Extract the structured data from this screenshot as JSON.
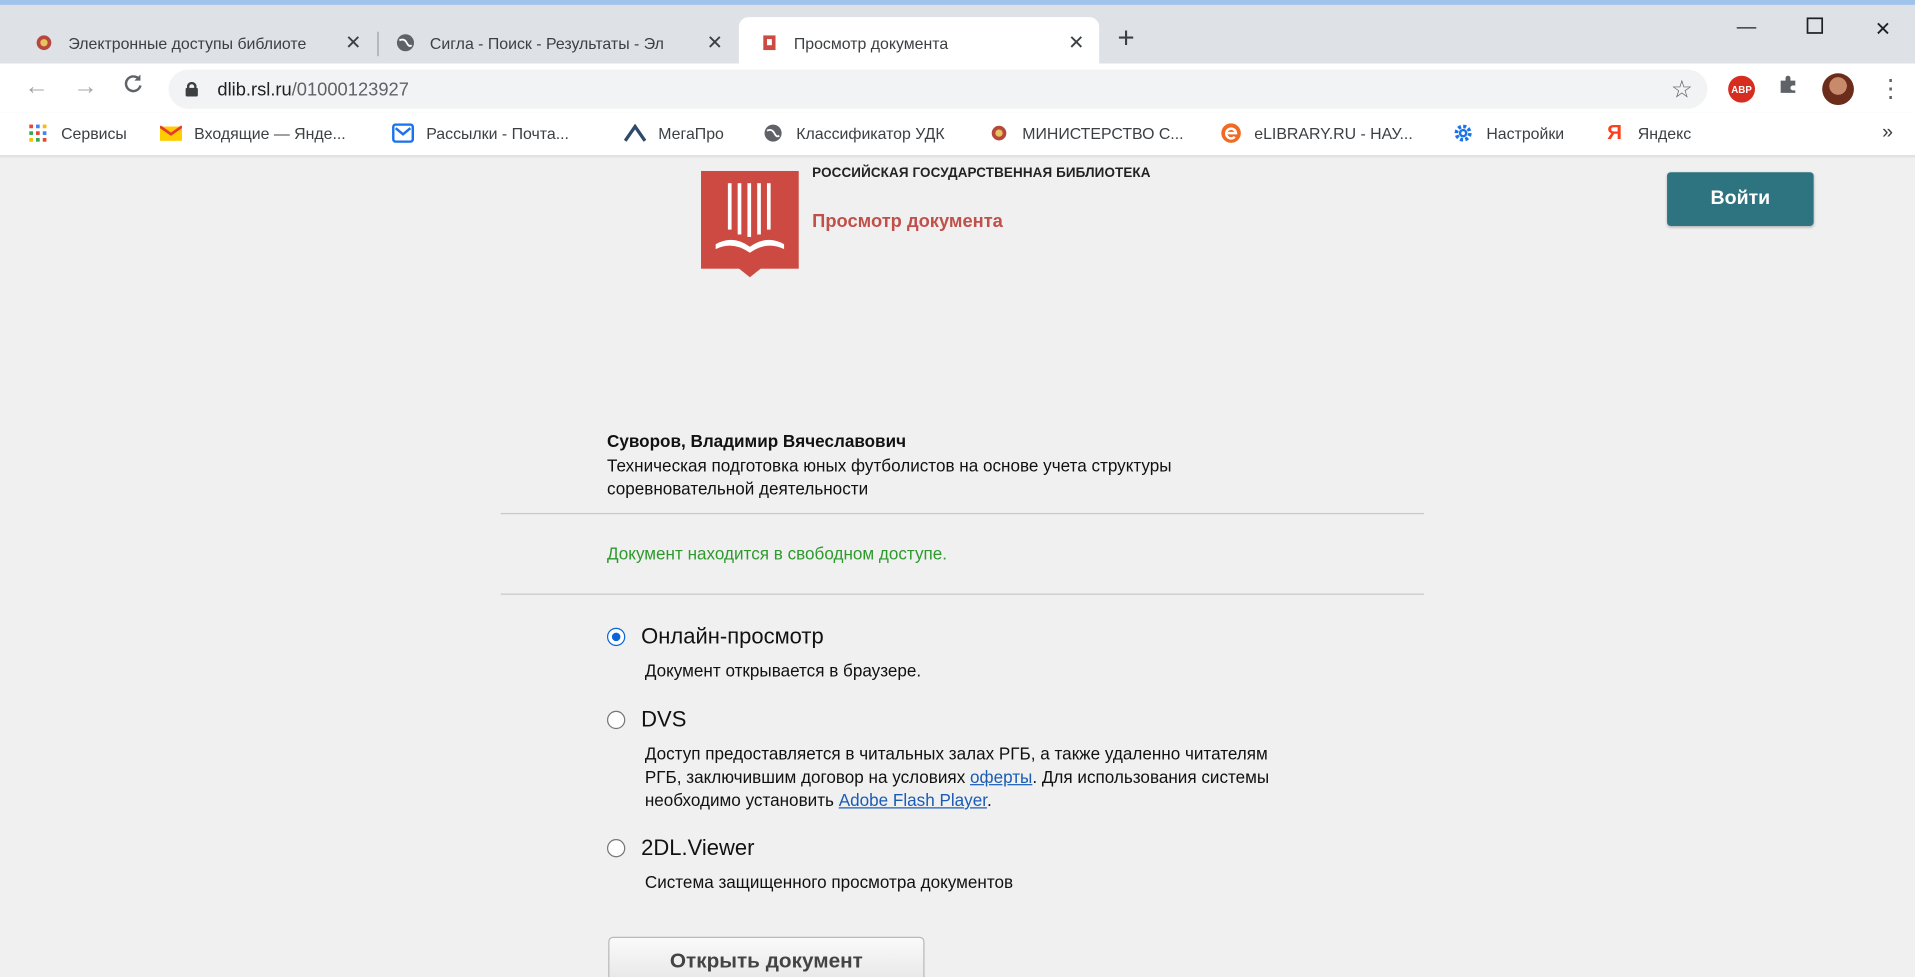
{
  "browser": {
    "tabs": [
      {
        "title": "Электронные доступы библиоте",
        "active": false
      },
      {
        "title": "Сигла - Поиск - Результаты - Эл",
        "active": false
      },
      {
        "title": "Просмотр документа",
        "active": true
      }
    ],
    "new_tab": "+",
    "url_host": "dlib.rsl.ru",
    "url_path": "/01000123927",
    "extension_abp": "ABP",
    "bookmarks": [
      {
        "label": "Сервисы",
        "icon": "apps-grid-icon"
      },
      {
        "label": "Входящие — Янде...",
        "icon": "yandex-mail-icon"
      },
      {
        "label": "Рассылки - Почта...",
        "icon": "mail-icon"
      },
      {
        "label": "МегаПро",
        "icon": "megapro-icon"
      },
      {
        "label": "Классификатор УДК",
        "icon": "globe-icon"
      },
      {
        "label": "МИНИСТЕРСТВО С...",
        "icon": "emblem-icon"
      },
      {
        "label": "eLIBRARY.RU - НАУ...",
        "icon": "elibrary-icon"
      },
      {
        "label": "Настройки",
        "icon": "gear-icon"
      },
      {
        "label": "Яндекс",
        "icon": "yandex-icon"
      }
    ],
    "bookmarks_overflow": "»"
  },
  "header": {
    "library_name": "РОССИЙСКАЯ ГОСУДАРСТВЕННАЯ БИБЛИОТЕКА",
    "page_title": "Просмотр документа",
    "login_label": "Войти"
  },
  "document": {
    "author": "Суворов, Владимир Вячеславович",
    "title": "Техническая подготовка юных футболистов на основе учета структуры соревновательной деятельности",
    "access_status": "Документ находится в свободном доступе."
  },
  "options": [
    {
      "label": "Онлайн-просмотр",
      "selected": true,
      "description": "Документ открывается в браузере."
    },
    {
      "label": "DVS",
      "selected": false,
      "desc_part1": "Доступ предоставляется в читальных залах РГБ, а также удаленно читателям РГБ, заключившим договор на условиях ",
      "desc_link1": "оферты",
      "desc_part2": ". Для использования системы необходимо установить ",
      "desc_link2": "Adobe Flash Player",
      "desc_part3": "."
    },
    {
      "label": "2DL.Viewer",
      "selected": false,
      "description": "Система защищенного просмотра документов"
    }
  ],
  "open_button": "Открыть документ",
  "colors": {
    "accent": "#2d7380",
    "brand_red": "#cc4a42",
    "success": "#2e9a2e"
  }
}
